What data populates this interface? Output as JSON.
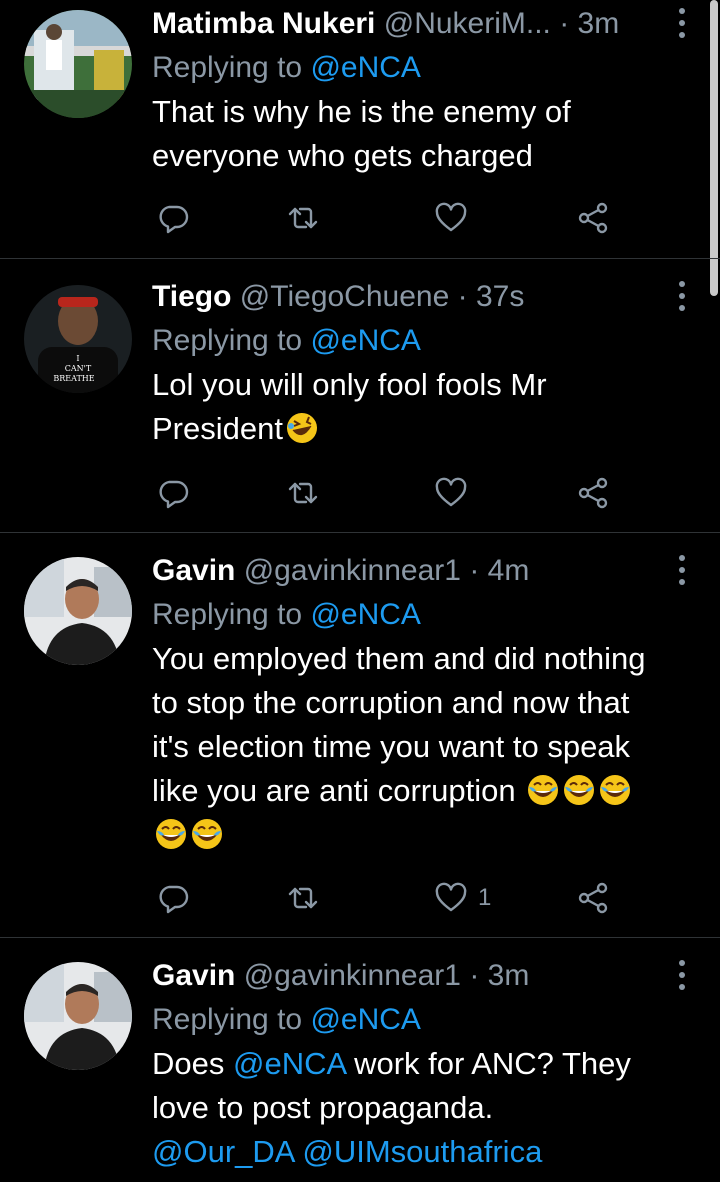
{
  "tweets": [
    {
      "name": "Matimba Nukeri",
      "handle": "@NukeriM...",
      "time": "· 3m",
      "replying_prefix": "Replying to",
      "replying_to": "@eNCA",
      "text_lines": [
        "That is why he is the enemy of",
        "everyone who gets charged"
      ],
      "like_count": ""
    },
    {
      "name": "Tiego",
      "handle": "@TiegoChuene",
      "time": "· 37s",
      "replying_prefix": "Replying to",
      "replying_to": "@eNCA",
      "text_lines": [
        "Lol you will only fool fools Mr",
        "President"
      ],
      "avatar_shirt_text": [
        "I",
        "CAN'T",
        "BREATHE"
      ],
      "like_count": ""
    },
    {
      "name": "Gavin",
      "handle": "@gavinkinnear1",
      "time": "· 4m",
      "replying_prefix": "Replying to",
      "replying_to": "@eNCA",
      "text_lines": [
        "You employed them and did nothing",
        "to stop the corruption and now that",
        "it's election time you want to speak",
        "like you are anti corruption"
      ],
      "like_count": "1"
    },
    {
      "name": "Gavin",
      "handle": "@gavinkinnear1",
      "time": "· 3m",
      "replying_prefix": "Replying to",
      "replying_to": "@eNCA",
      "text_lines": [
        "Does",
        "@eNCA",
        "work for ANC?  They",
        "love to post propaganda.",
        "@Our_DA",
        "@UIMsouthafrica"
      ],
      "like_count": ""
    }
  ],
  "icons": {
    "reply": "reply-icon",
    "retweet": "retweet-icon",
    "like": "heart-icon",
    "share": "share-icon",
    "more": "more-vertical-icon",
    "emoji_rofl": "rolling-on-floor-laughing-emoji",
    "emoji_joy": "face-with-tears-of-joy-emoji"
  },
  "colors": {
    "background": "#000000",
    "text": "#ffffff",
    "secondary": "#8b98a5",
    "link": "#1d9bf0",
    "divider": "#2f3336"
  }
}
